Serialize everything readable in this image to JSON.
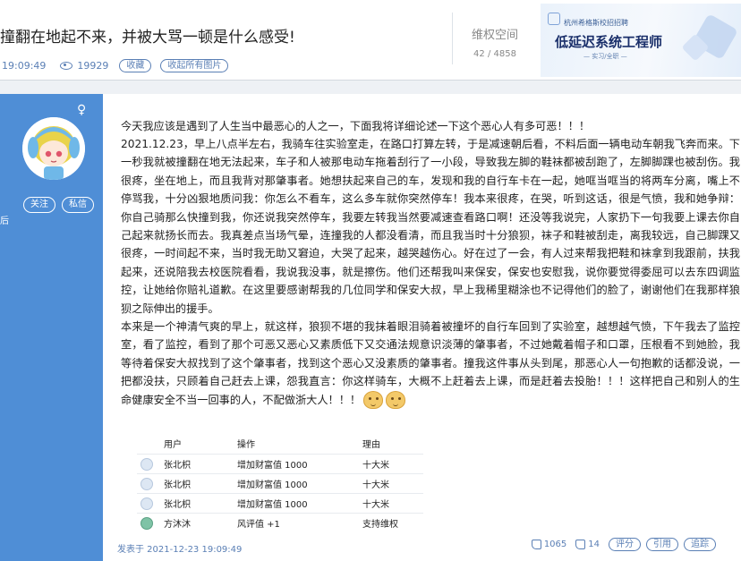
{
  "post": {
    "title": "撞翻在地起不来，并被大骂一顿是什么感受!",
    "time": "19:09:49",
    "views": "19929",
    "favorite_label": "收藏",
    "favorite_images_label": "收起所有图片"
  },
  "rights": {
    "label": "维权空间",
    "count": "42 / 4858"
  },
  "ad": {
    "small_text": "杭州希格斯校招招聘",
    "big_text": "低延迟系统工程师",
    "tag": "— 实习/全职 —"
  },
  "user": {
    "gender_symbol": "♀",
    "follow_label": "关注",
    "message_label": "私信",
    "edge_text": "后"
  },
  "content": {
    "p1": "今天我应该是遇到了人生当中最恶心的人之一，下面我将详细论述一下这个恶心人有多可恶！！！",
    "p2": "2021.12.23，早上八点半左右，我骑车往实验室走，在路口打算左转，于是减速朝后看，不料后面一辆电动车朝我飞奔而来。下一秒我就被撞翻在地无法起来，车子和人被那电动车拖着刮行了一小段，导致我左脚的鞋袜都被刮跑了，左脚脚踝也被刮伤。我很疼，坐在地上，而且我背对那肇事者。她想扶起来自己的车，发现和我的自行车卡在一起，她哐当哐当的将两车分离，嘴上不停骂我，十分凶狠地质问我：你怎么不看车，这么多车就你突然停车！我本来很疼，在哭，听到这话，很是气愤，我和她争辩：你自己骑那么快撞到我，你还说我突然停车，我要左转我当然要减速查看路口啊！还没等我说完，人家扔下一句我要上课去你自己起来就扬长而去。我真差点当场气晕，连撞我的人都没看清，而且我当时十分狼狈，袜子和鞋被刮走，离我较远，自己脚踝又很疼，一时间起不来，当时我无助又窘迫，大哭了起来，越哭越伤心。好在过了一会，有人过来帮我把鞋和袜拿到我跟前，扶我起来，还说陪我去校医院看看，我说我没事，就是擦伤。他们还帮我叫来保安，保安也安慰我，说你要觉得委屈可以去东四调监控，让她给你赔礼道歉。在这里要感谢帮我的几位同学和保安大叔，早上我稀里糊涂也不记得他们的脸了，谢谢他们在我那样狼狈之际伸出的援手。",
    "p3": "本来是一个神清气爽的早上，就这样，狼狈不堪的我抹着眼泪骑着被撞坏的自行车回到了实验室，越想越气愤，下午我去了监控室，看了监控，看到了那个可恶又恶心又素质低下又交通法规意识淡薄的肇事者，不过她戴着帽子和口罩，压根看不到她脸，我等待着保安大叔找到了这个肇事者，找到这个恶心又没素质的肇事者。撞我这件事从头到尾，那恶心人一句抱歉的话都没说，一把都没扶，只顾着自己赶去上课，怨我直言：你这样骑车，大概不上赶着去上课，而是赶着去投胎！！！这样把自己和别人的生命健康安全不当一回事的人，不配做浙大人！！！"
  },
  "ratings": {
    "headers": {
      "user": "用户",
      "action": "操作",
      "reason": "理由"
    },
    "rows": [
      {
        "user": "张北枳",
        "action": "增加财富值 1000",
        "reason": "十大米"
      },
      {
        "user": "张北枳",
        "action": "增加财富值 1000",
        "reason": "十大米"
      },
      {
        "user": "张北枳",
        "action": "增加财富值 1000",
        "reason": "十大米"
      },
      {
        "user": "方沐沐",
        "action": "风评值 +1",
        "reason": "支持维权"
      }
    ]
  },
  "footer": {
    "posted": "发表于 2021-12-23 19:09:49",
    "likes": "1065",
    "dislikes": "14",
    "rate_label": "评分",
    "quote_label": "引用",
    "trace_label": "追踪"
  },
  "colors": {
    "panel_blue": "#4f8ed6",
    "link_blue": "#5a7fb5"
  },
  "icons": [
    "eye-icon",
    "female-icon",
    "avatar",
    "thumb-up-icon",
    "thumb-down-icon",
    "emoji-icon",
    "user-icon"
  ]
}
